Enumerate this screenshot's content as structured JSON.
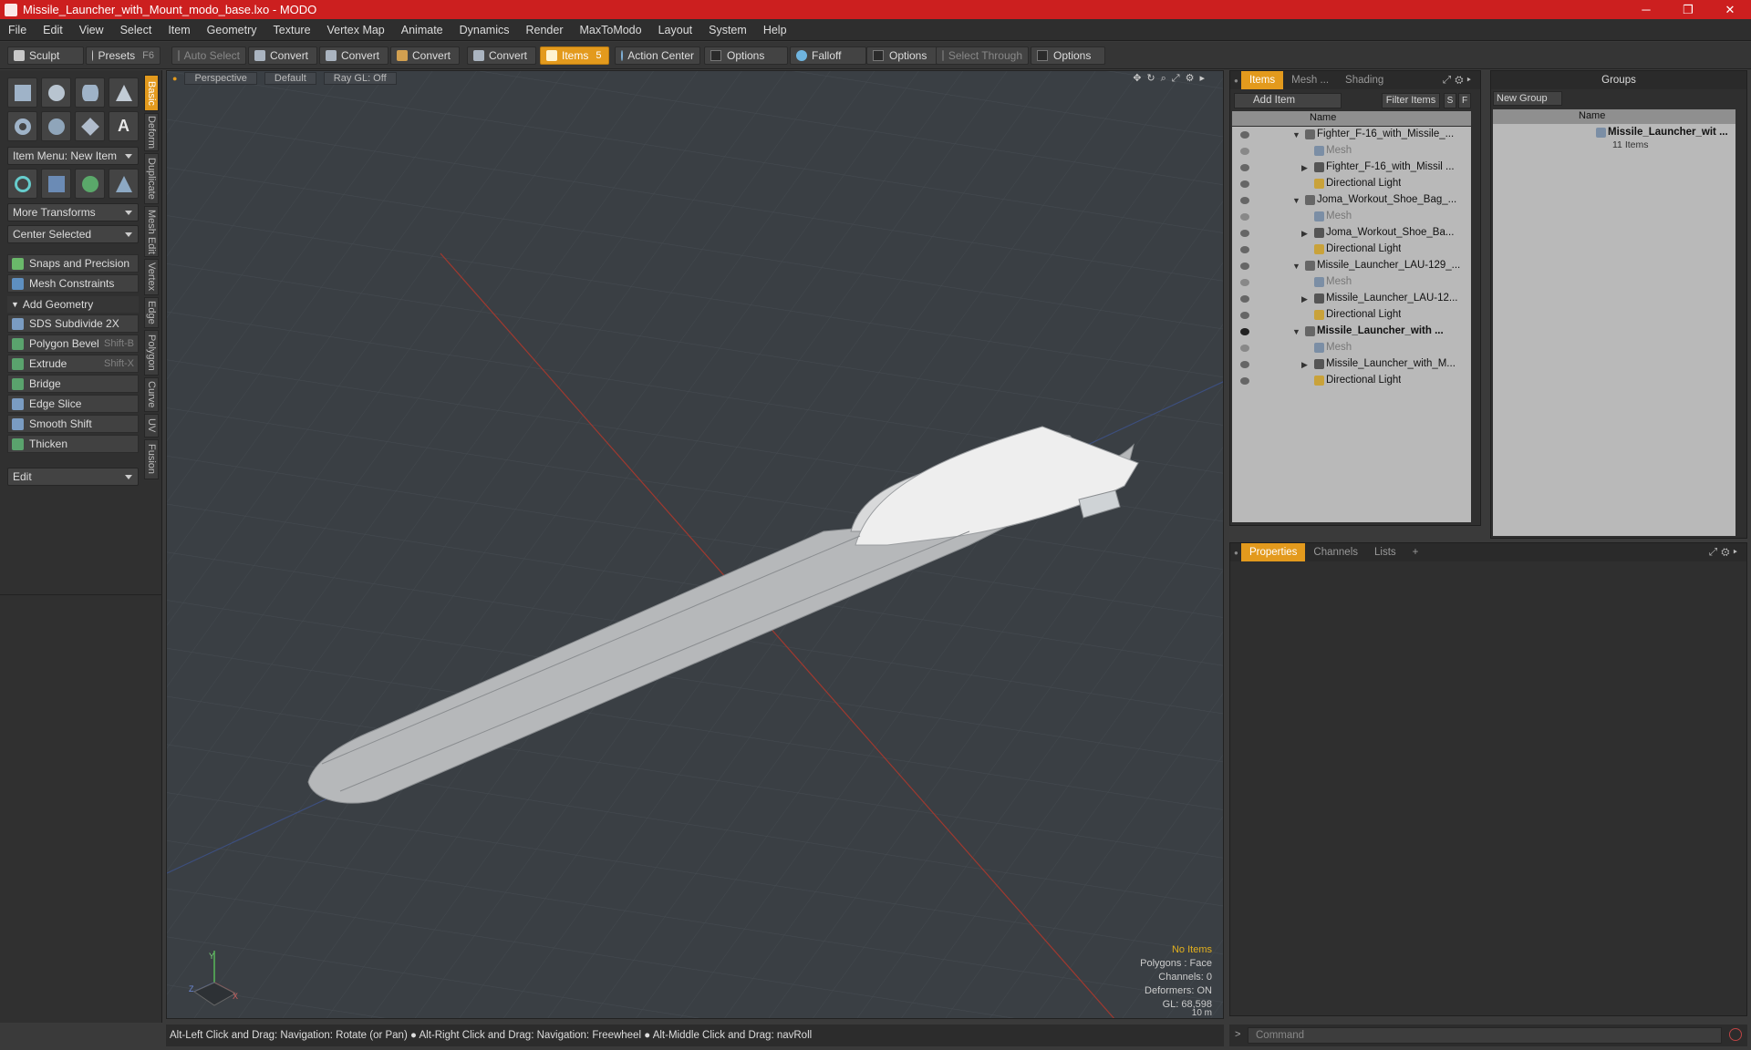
{
  "window": {
    "title": "Missile_Launcher_with_Mount_modo_base.lxo - MODO",
    "minimize": "─",
    "maximize": "❐",
    "close": "✕"
  },
  "menu": [
    "File",
    "Edit",
    "View",
    "Select",
    "Item",
    "Geometry",
    "Texture",
    "Vertex Map",
    "Animate",
    "Dynamics",
    "Render",
    "MaxToModo",
    "Layout",
    "System",
    "Help"
  ],
  "toolbar": {
    "sculpt": "Sculpt",
    "presets": "Presets",
    "presets_key": "F6",
    "auto_select": "Auto Select",
    "convert1": "Convert",
    "convert2": "Convert",
    "convert3": "Convert",
    "convert4": "Convert",
    "items": "Items",
    "items_key": "5",
    "action_center": "Action Center",
    "options1": "Options",
    "falloff": "Falloff",
    "options2": "Options",
    "select_through": "Select Through",
    "options3": "Options"
  },
  "left": {
    "item_menu": "Item Menu: New Item",
    "more_transforms": "More Transforms",
    "center_selected": "Center Selected",
    "snaps": "Snaps and Precision",
    "mesh_constraints": "Mesh Constraints",
    "add_geometry": "Add Geometry",
    "tools": [
      {
        "label": "SDS Subdivide 2X",
        "key": ""
      },
      {
        "label": "Polygon Bevel",
        "key": "Shift-B"
      },
      {
        "label": "Extrude",
        "key": "Shift-X"
      },
      {
        "label": "Bridge",
        "key": ""
      },
      {
        "label": "Edge Slice",
        "key": ""
      },
      {
        "label": "Smooth Shift",
        "key": ""
      },
      {
        "label": "Thicken",
        "key": ""
      }
    ],
    "edit": "Edit",
    "vtabs": [
      "Basic",
      "Deform",
      "Duplicate",
      "Mesh Edit",
      "Vertex",
      "Edge",
      "Polygon",
      "Curve",
      "UV",
      "Fusion"
    ]
  },
  "viewport": {
    "view": "Perspective",
    "shading": "Default",
    "raygl": "Ray GL: Off",
    "info": [
      "No Items",
      "Polygons : Face",
      "Channels: 0",
      "Deformers: ON",
      "GL: 68,598",
      "10 m"
    ],
    "axis_y": "Y",
    "axis_x": "X",
    "axis_z": "Z"
  },
  "status": "Alt-Left Click and Drag: Navigation: Rotate (or Pan) ● Alt-Right Click and Drag: Navigation: Freewheel ● Alt-Middle Click and Drag: navRoll",
  "items_panel": {
    "tabs": [
      "Items",
      "Mesh ...",
      "Shading"
    ],
    "add_item": "Add Item",
    "filter_items": "Filter Items",
    "s": "S",
    "f": "F",
    "name_col": "Name",
    "rows": [
      {
        "label": "Fighter_F-16_with_Missile_...",
        "depth": 0,
        "type": "scene",
        "dim": false,
        "bold": false
      },
      {
        "label": "Mesh",
        "depth": 2,
        "type": "mesh",
        "dim": true,
        "bold": false
      },
      {
        "label": "Fighter_F-16_with_Missil ...",
        "depth": 1,
        "type": "group",
        "dim": false,
        "bold": false
      },
      {
        "label": "Directional Light",
        "depth": 2,
        "type": "light",
        "dim": false,
        "bold": false
      },
      {
        "label": "Joma_Workout_Shoe_Bag_...",
        "depth": 0,
        "type": "scene",
        "dim": false,
        "bold": false
      },
      {
        "label": "Mesh",
        "depth": 2,
        "type": "mesh",
        "dim": true,
        "bold": false
      },
      {
        "label": "Joma_Workout_Shoe_Ba...",
        "depth": 1,
        "type": "group",
        "dim": false,
        "bold": false
      },
      {
        "label": "Directional Light",
        "depth": 2,
        "type": "light",
        "dim": false,
        "bold": false
      },
      {
        "label": "Missile_Launcher_LAU-129_...",
        "depth": 0,
        "type": "scene",
        "dim": false,
        "bold": false
      },
      {
        "label": "Mesh",
        "depth": 2,
        "type": "mesh",
        "dim": true,
        "bold": false
      },
      {
        "label": "Missile_Launcher_LAU-12...",
        "depth": 1,
        "type": "group",
        "dim": false,
        "bold": false
      },
      {
        "label": "Directional Light",
        "depth": 2,
        "type": "light",
        "dim": false,
        "bold": false
      },
      {
        "label": "Missile_Launcher_with ...",
        "depth": 0,
        "type": "scene",
        "dim": false,
        "bold": true
      },
      {
        "label": "Mesh",
        "depth": 2,
        "type": "mesh",
        "dim": true,
        "bold": false
      },
      {
        "label": "Missile_Launcher_with_M...",
        "depth": 1,
        "type": "group",
        "dim": false,
        "bold": false
      },
      {
        "label": "Directional Light",
        "depth": 2,
        "type": "light",
        "dim": false,
        "bold": false
      }
    ]
  },
  "groups_panel": {
    "title": "Groups",
    "new_group": "New Group",
    "name_col": "Name",
    "group_name": "Missile_Launcher_wit ...",
    "group_count": "11 Items"
  },
  "props_panel": {
    "tabs": [
      "Properties",
      "Channels",
      "Lists",
      "+"
    ]
  },
  "command": {
    "placeholder": "Command"
  },
  "colors": {
    "accent": "#e39a1d",
    "title_bar": "#cc1f1f",
    "viewport_bg": "#3a3f44"
  }
}
